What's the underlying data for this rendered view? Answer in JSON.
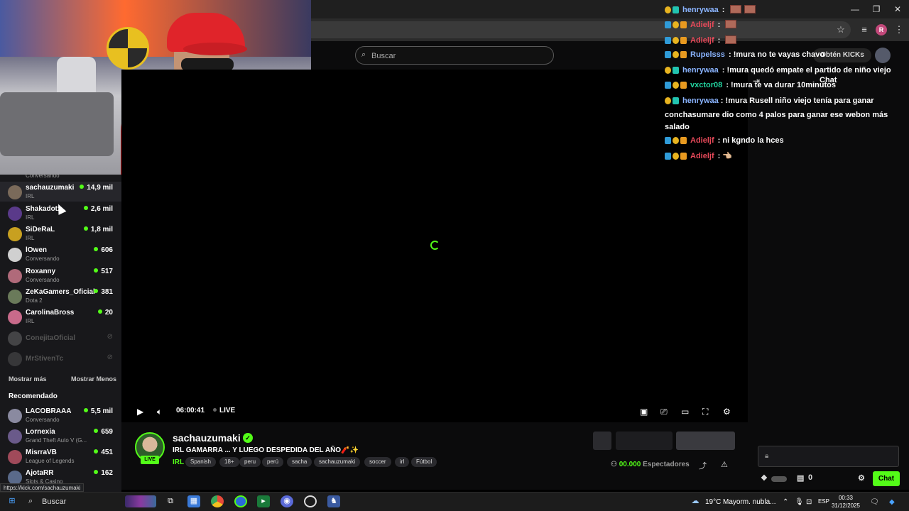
{
  "browser": {
    "window_controls": [
      "—",
      "❐",
      "✕"
    ],
    "toolbar_icons": [
      "star-icon",
      "playlist-icon",
      "menu-icon"
    ],
    "profile_initial": "R"
  },
  "header": {
    "search_placeholder": "Buscar",
    "obten_label": "Obtén KICKs",
    "chat_label": "Chat"
  },
  "sidebar": {
    "top_partial_category": "Conversando",
    "channels": [
      {
        "name": "sachauzumaki",
        "category": "IRL",
        "viewers": "14,9 mil",
        "live": true,
        "color": "#7a6a5a"
      },
      {
        "name": "Shakadotx",
        "category": "IRL",
        "viewers": "2,6 mil",
        "live": true,
        "color": "#5a3a8a"
      },
      {
        "name": "SiDeRaL",
        "category": "IRL",
        "viewers": "1,8 mil",
        "live": true,
        "color": "#c8a020"
      },
      {
        "name": "lOwen",
        "category": "Conversando",
        "viewers": "606",
        "live": true,
        "color": "#d0d0d0"
      },
      {
        "name": "Roxanny",
        "category": "Conversando",
        "viewers": "517",
        "live": true,
        "color": "#b06a7a"
      },
      {
        "name": "ZeKaGamers_Oficial",
        "category": "Dota 2",
        "viewers": "381",
        "live": true,
        "color": "#6a7a5a"
      },
      {
        "name": "CarolinaBross",
        "category": "IRL",
        "viewers": "20",
        "live": true,
        "color": "#c86a8a"
      },
      {
        "name": "ConejitaOficial",
        "category": "",
        "viewers": "",
        "live": false,
        "color": "#888"
      },
      {
        "name": "MrStivenTc",
        "category": "",
        "viewers": "",
        "live": false,
        "color": "#666"
      }
    ],
    "show_more": "Mostrar más",
    "show_less": "Mostrar Menos",
    "recommended_title": "Recomendado",
    "recommended": [
      {
        "name": "LACOBRAAA",
        "category": "Conversando",
        "viewers": "5,5 mil",
        "color": "#8a8aa0"
      },
      {
        "name": "Lornexia",
        "category": "Grand Theft Auto V (G...",
        "viewers": "659",
        "color": "#6a5a8a"
      },
      {
        "name": "MisrraVB",
        "category": "League of Legends",
        "viewers": "451",
        "color": "#a04a5a"
      },
      {
        "name": "AjotaRR",
        "category": "Slots & Casino",
        "viewers": "162",
        "color": "#5a6a8a"
      }
    ],
    "url_tooltip": "https://kick.com/sachauzumaki"
  },
  "player": {
    "time": "06:00:41",
    "live_label": "LIVE"
  },
  "streamer": {
    "name": "sachauzumaki",
    "live_badge": "LIVE",
    "title": "IRL GAMARRA ... Y LUEGO DESPEDIDA DEL AÑO🧨✨",
    "category": "IRL",
    "tags": [
      "Spanish",
      "18+",
      "peru",
      "perú",
      "sacha",
      "sachauzumaki",
      "soccer",
      "irl",
      "Fútbol"
    ],
    "viewers_count": "00.000",
    "viewers_label": "Espectadores"
  },
  "chat": {
    "messages": [
      {
        "user": "henrywaa",
        "user_color": "#8ab4ff",
        "text": "",
        "emotes": 2
      },
      {
        "user": "Adieljf",
        "user_color": "#e84a5a",
        "text": "",
        "emotes": 1
      },
      {
        "user": "Adieljf",
        "user_color": "#e84a5a",
        "text": "",
        "emotes": 1
      },
      {
        "user": "Rupelsss",
        "user_color": "#8ab4ff",
        "text": "!mura no te vayas chavo",
        "emotes": 0
      },
      {
        "user": "henrywaa",
        "user_color": "#8ab4ff",
        "text": "!mura quedó empate el partido de niño viejo",
        "emotes": 0
      },
      {
        "user": "vxctor08",
        "user_color": "#22d4a0",
        "text": "!mura te va durar 10minutos",
        "emotes": 0
      }
    ],
    "long_message": {
      "user": "henrywaa",
      "user_color": "#8ab4ff",
      "text": "!mura Rusell niño viejo tenía para ganar conchasumare dio como 4 palos para ganar ese webon más salado"
    },
    "tail_messages": [
      {
        "user": "Adieljf",
        "user_color": "#e84a5a",
        "text": "ni kgndo la hces"
      },
      {
        "user": "Adieljf",
        "user_color": "#e84a5a",
        "text": "👈🏼"
      }
    ],
    "points": "0",
    "send_label": "Chat"
  },
  "taskbar": {
    "search": "Buscar",
    "weather": "19°C",
    "weather_text": "Mayorm. nubla...",
    "lang": "ESP",
    "time": "00:33",
    "date": "31/12/2025"
  }
}
